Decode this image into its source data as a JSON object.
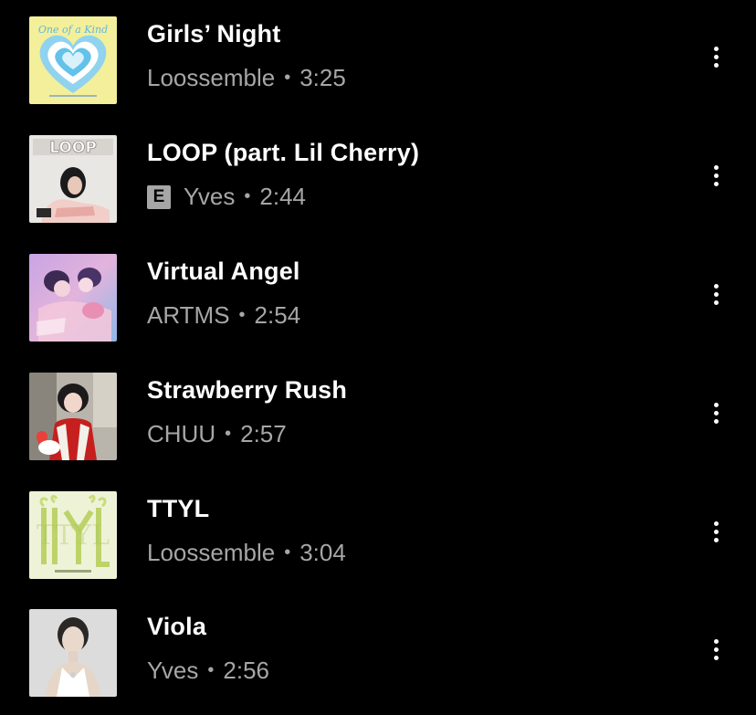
{
  "tracks": [
    {
      "title": "Girls’ Night",
      "artist": "Loossemble",
      "duration": "3:25",
      "explicit": false,
      "art_icon": "album-art-one-of-a-kind",
      "art_text": "One of a Kind"
    },
    {
      "title": "LOOP (part. Lil Cherry)",
      "artist": "Yves",
      "duration": "2:44",
      "explicit": true,
      "explicit_label": "E",
      "art_icon": "album-art-loop",
      "art_text": "LOOP"
    },
    {
      "title": "Virtual Angel",
      "artist": "ARTMS",
      "duration": "2:54",
      "explicit": false,
      "art_icon": "album-art-virtual-angel"
    },
    {
      "title": "Strawberry Rush",
      "artist": "CHUU",
      "duration": "2:57",
      "explicit": false,
      "art_icon": "album-art-strawberry-rush"
    },
    {
      "title": "TTYL",
      "artist": "Loossemble",
      "duration": "3:04",
      "explicit": false,
      "art_icon": "album-art-ttyl",
      "art_text": "TTYL"
    },
    {
      "title": "Viola",
      "artist": "Yves",
      "duration": "2:56",
      "explicit": false,
      "art_icon": "album-art-viola"
    }
  ],
  "separator": "•",
  "more_icon": "more-vertical-icon"
}
